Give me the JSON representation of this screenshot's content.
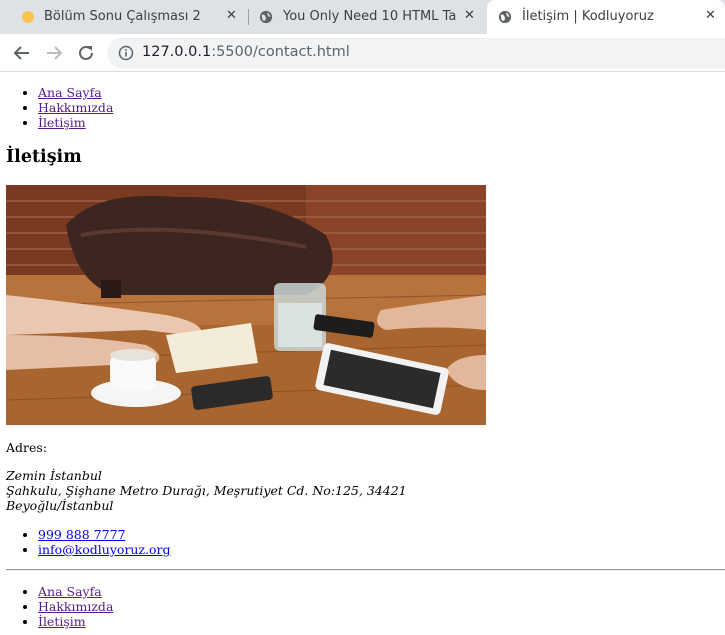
{
  "browser": {
    "tabs": [
      {
        "title": "Bölüm Sonu Çalışması 2"
      },
      {
        "title": "You Only Need 10 HTML Ta"
      },
      {
        "title": "İletişim | Kodluyoruz"
      }
    ],
    "close_glyph": "✕",
    "url_host": "127.0.0.1",
    "url_path": ":5500/contact.html"
  },
  "page": {
    "nav_top": [
      "Ana Sayfa",
      "Hakkımızda",
      "İletişim"
    ],
    "heading": "İletişim",
    "image": {
      "subject": "meeting-table-photo"
    },
    "address_label": "Adres:",
    "address_lines": [
      "Zemin İstanbul",
      "Şahkulu, Şişhane Metro Durağı, Meşrutiyet Cd. No:125, 34421",
      "Beyoğlu/İstanbul"
    ],
    "contacts": [
      "999 888 7777",
      "info@kodluyoruz.org"
    ],
    "nav_bottom": [
      "Ana Sayfa",
      "Hakkımızda",
      "İletişim"
    ]
  },
  "colors": {
    "link_visited": "#551a8b",
    "link_unvisited": "#0000ee",
    "tabbar_bg": "#dee1e6",
    "omnibox_bg": "#f1f3f4"
  }
}
